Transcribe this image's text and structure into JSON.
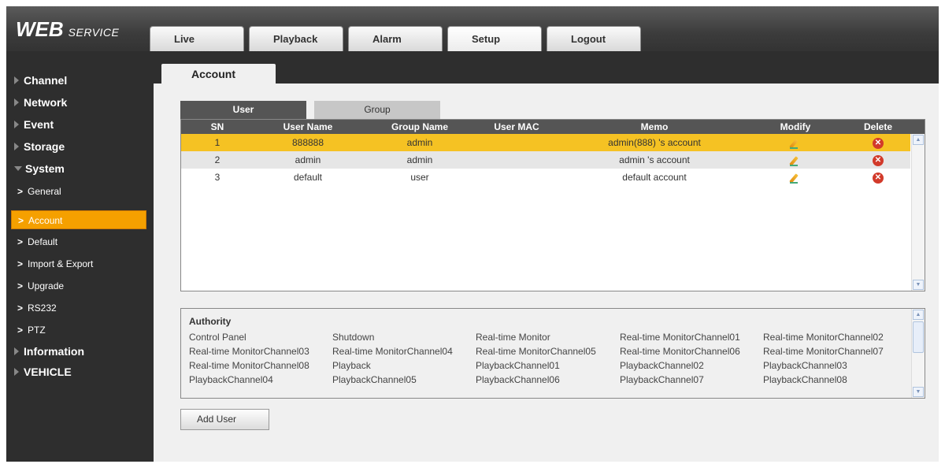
{
  "logo": {
    "main": "WEB",
    "sub": "SERVICE"
  },
  "topnav": [
    "Live",
    "Playback",
    "Alarm",
    "Setup",
    "Logout"
  ],
  "sidebar": {
    "main_items": [
      "Channel",
      "Network",
      "Event",
      "Storage",
      "System",
      "Information",
      "VEHICLE"
    ],
    "system_subitems": [
      "General",
      "Account",
      "Default",
      "Import & Export",
      "Upgrade",
      "RS232",
      "PTZ"
    ],
    "active": "Account"
  },
  "content": {
    "tab": "Account",
    "subtabs": [
      "User",
      "Group"
    ],
    "table": {
      "headers": [
        "SN",
        "User Name",
        "Group Name",
        "User MAC",
        "Memo",
        "Modify",
        "Delete"
      ],
      "rows": [
        {
          "sn": "1",
          "user": "888888",
          "group": "admin",
          "mac": "",
          "memo": "admin(888) 's account"
        },
        {
          "sn": "2",
          "user": "admin",
          "group": "admin",
          "mac": "",
          "memo": "admin 's account"
        },
        {
          "sn": "3",
          "user": "default",
          "group": "user",
          "mac": "",
          "memo": "default account"
        }
      ]
    },
    "authority": {
      "title": "Authority",
      "items": [
        "Control Panel",
        "Shutdown",
        "Real-time Monitor",
        "Real-time MonitorChannel01",
        "Real-time MonitorChannel02",
        "Real-time MonitorChannel03",
        "Real-time MonitorChannel04",
        "Real-time MonitorChannel05",
        "Real-time MonitorChannel06",
        "Real-time MonitorChannel07",
        "Real-time MonitorChannel08",
        "Playback",
        "PlaybackChannel01",
        "PlaybackChannel02",
        "PlaybackChannel03",
        "PlaybackChannel04",
        "PlaybackChannel05",
        "PlaybackChannel06",
        "PlaybackChannel07",
        "PlaybackChannel08"
      ]
    },
    "add_button": "Add User"
  }
}
